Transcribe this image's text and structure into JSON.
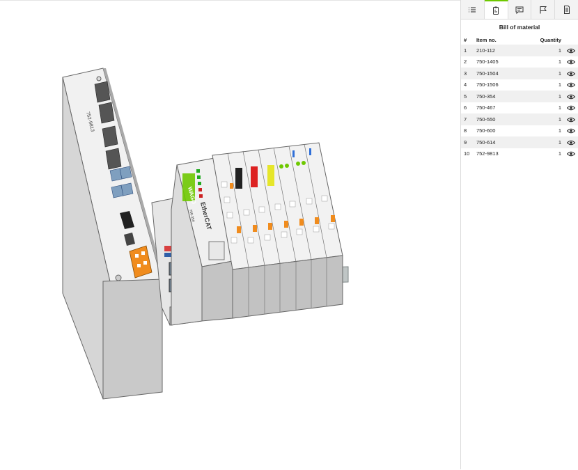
{
  "panel": {
    "tabs": [
      {
        "icon": "list-icon"
      },
      {
        "icon": "clipboard-icon"
      },
      {
        "icon": "comment-icon"
      },
      {
        "icon": "flag-icon"
      },
      {
        "icon": "document-icon"
      }
    ],
    "active_tab": 1,
    "title": "Bill of material",
    "columns": {
      "num": "#",
      "item": "Item no.",
      "qty": "Quantity"
    },
    "rows": [
      {
        "num": "1",
        "item": "210-112",
        "qty": "1"
      },
      {
        "num": "2",
        "item": "750-1405",
        "qty": "1"
      },
      {
        "num": "3",
        "item": "750-1504",
        "qty": "1"
      },
      {
        "num": "4",
        "item": "750-1506",
        "qty": "1"
      },
      {
        "num": "5",
        "item": "750-354",
        "qty": "1"
      },
      {
        "num": "6",
        "item": "750-467",
        "qty": "1"
      },
      {
        "num": "7",
        "item": "750-550",
        "qty": "1"
      },
      {
        "num": "8",
        "item": "750-600",
        "qty": "1"
      },
      {
        "num": "9",
        "item": "750-614",
        "qty": "1"
      },
      {
        "num": "10",
        "item": "752-9813",
        "qty": "1"
      }
    ]
  },
  "model": {
    "controller_label": "752-9813",
    "coupler_label": "750-354",
    "brand": "WAGO",
    "fieldbus": "EtherCAT"
  },
  "colors": {
    "accent": "#6ec800",
    "orange": "#f08c1e"
  }
}
